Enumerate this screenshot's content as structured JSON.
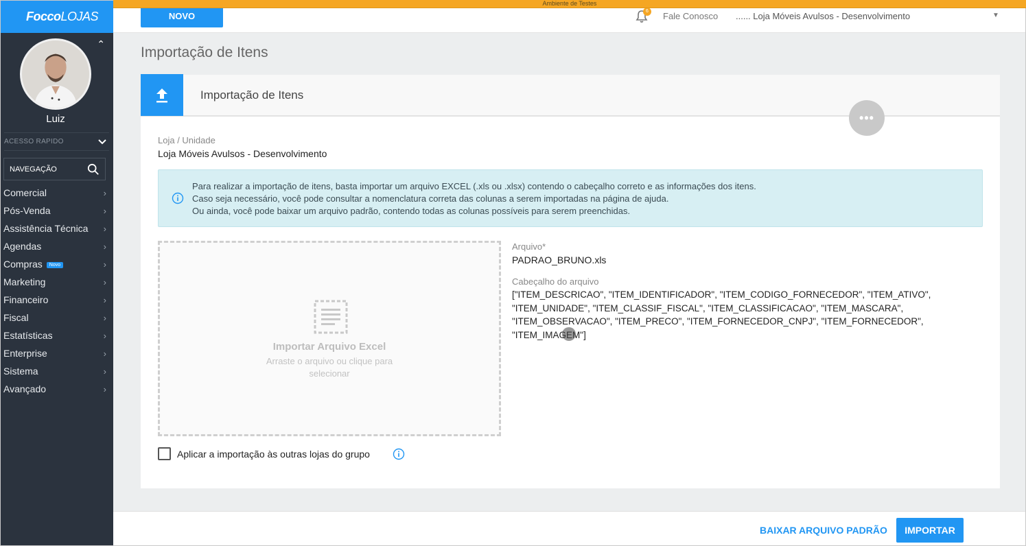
{
  "env": {
    "label": "Ambiente de Testes"
  },
  "sidebar": {
    "logo_bold": "Focco",
    "logo_thin": "LOJAS",
    "user_name": "Luiz",
    "quick_access": "ACESSO RAPIDO",
    "nav_search_label": "NAVEGAÇÃO",
    "items": [
      {
        "label": "Comercial"
      },
      {
        "label": "Pós-Venda"
      },
      {
        "label": "Assistência Técnica"
      },
      {
        "label": "Agendas"
      },
      {
        "label": "Compras",
        "badge": "Novo"
      },
      {
        "label": "Marketing"
      },
      {
        "label": "Financeiro"
      },
      {
        "label": "Fiscal"
      },
      {
        "label": "Estatísticas"
      },
      {
        "label": "Enterprise"
      },
      {
        "label": "Sistema"
      },
      {
        "label": "Avançado"
      }
    ]
  },
  "topbar": {
    "new_button": "NOVO",
    "notification_count": "6",
    "contact_link": "Fale Conosco",
    "store_selector": "...... Loja Móveis Avulsos - Desenvolvimento"
  },
  "page": {
    "title": "Importação de Itens",
    "card_title": "Importação de Itens",
    "store_label": "Loja / Unidade",
    "store_value": "Loja Móveis Avulsos - Desenvolvimento",
    "info_lines": [
      "Para realizar a importação de itens, basta importar um arquivo EXCEL (.xls ou .xlsx) contendo o cabeçalho correto e as informações dos itens.",
      "Caso seja necessário, você pode consultar a nomenclatura correta das colunas a serem importadas na página de ajuda.",
      "Ou ainda, você pode baixar um arquivo padrão, contendo todas as colunas possíveis para serem preenchidas."
    ],
    "dropzone_title": "Importar Arquivo Excel",
    "dropzone_sub": "Arraste o arquivo ou clique para selecionar",
    "file_label": "Arquivo*",
    "file_value": "PADRAO_BRUNO.xls",
    "header_label": "Cabeçalho do arquivo",
    "header_lines": [
      "[\"ITEM_DESCRICAO\", \"ITEM_IDENTIFICADOR\", \"ITEM_CODIGO_FORNECEDOR\", \"ITEM_ATIVO\",",
      "\"ITEM_UNIDADE\", \"ITEM_CLASSIF_FISCAL\", \"ITEM_CLASSIFICACAO\", \"ITEM_MASCARA\",",
      "\"ITEM_OBSERVACAO\", \"ITEM_PRECO\", \"ITEM_FORNECEDOR_CNPJ\", \"ITEM_FORNECEDOR\",",
      "\"ITEM_IMAGEM\"]"
    ],
    "apply_group_label": "Aplicar a importação às outras lojas do grupo",
    "apply_group_checked": false
  },
  "footer": {
    "download_button": "BAIXAR ARQUIVO PADRÃO",
    "import_button": "IMPORTAR"
  },
  "colors": {
    "accent": "#2196f3",
    "sidebar": "#2b333e",
    "info_bg": "#d7eff3",
    "env": "#f5a623"
  }
}
